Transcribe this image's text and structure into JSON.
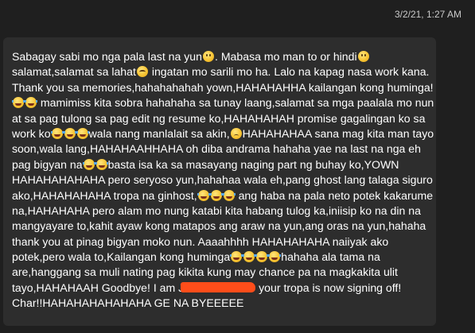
{
  "message": {
    "timestamp": "3/2/21, 1:27 AM",
    "lines": [
      [
        "Sabagay sabi mo nga pala last na yun",
        {
          "emoji": "smile"
        },
        ". Mabasa mo man to or hindi",
        {
          "emoji": "smile"
        }
      ],
      [
        "salamat,salamat sa lahat",
        {
          "emoji": "blush"
        },
        " ingatan mo sarili mo ha. Lalo na kapag nasa work kana."
      ],
      [
        "Thank you sa memories,hahahahahah yown,HAHAHAHHA kailangan kong huminga!"
      ],
      [
        {
          "emoji": "joy"
        },
        {
          "emoji": "joy"
        },
        " mamimiss kita sobra hahahaha sa tunay laang,salamat sa mga paalala mo nun"
      ],
      [
        "at sa pag tulong sa pag edit ng resume ko,HAHAHAHAH promise gagalingan ko sa"
      ],
      [
        "work ko",
        {
          "emoji": "joy"
        },
        {
          "emoji": "joy"
        },
        {
          "emoji": "joy"
        },
        "wala nang manlalait sa akin,",
        {
          "emoji": "sad"
        },
        "HAHAHAHAA sana mag kita man tayo"
      ],
      [
        "soon,wala lang,HAHAHAAHHAHA oh diba andrama hahaha yae na last na nga eh"
      ],
      [
        "pag bigyan na",
        {
          "emoji": "joy"
        },
        {
          "emoji": "joy"
        },
        "basta isa ka sa masayang naging part ng buhay ko,YOWN"
      ],
      [
        "HAHAHAHAHAHA pero seryoso yun,hahahaa wala eh,pang ghost lang talaga siguro"
      ],
      [
        "ako,HAHAHAHAHA tropa na ginhost,",
        {
          "emoji": "joy"
        },
        {
          "emoji": "joy"
        },
        {
          "emoji": "joy"
        },
        " ang haba na pala neto potek kakarume"
      ],
      [
        "na,HAHAHAHA pero alam mo nung katabi kita habang tulog ka,iniisip ko na din na"
      ],
      [
        "mangyayare to,kahit ayaw kong matapos ang araw na yun,ang oras na yun,hahaha"
      ],
      [
        "thank you at pinag bigyan moko nun. Aaaahhhh HAHAHAHAHA naiiyak ako"
      ],
      [
        "potek,pero wala to,Kailangan kong huminga",
        {
          "emoji": "joy"
        },
        {
          "emoji": "joy"
        },
        {
          "emoji": "joy"
        },
        {
          "emoji": "joy"
        },
        "hahaha ala tama na"
      ],
      [
        "are,hanggang sa muli nating pag kikita kung may chance pa na magkakita ulit"
      ],
      [
        "tayo,HAHAHAAH Goodbye! I am J",
        {
          "redacted": true
        },
        " your tropa is now signing off!"
      ],
      [
        "Char!!HAHAHAHAHAHAHA GE NA BYEEEEE"
      ]
    ]
  },
  "colors": {
    "background": "#1f1f1f",
    "bubble": "#2d2d2d",
    "text": "#ffffff",
    "timestamp": "#c9c9c9",
    "redaction": "#ff4d1a"
  },
  "icons": {
    "smile": "slightly-smiling-face-emoji",
    "blush": "smiling-face-with-smiling-eyes-emoji",
    "joy": "face-with-tears-of-joy-emoji",
    "sad": "pensive-face-emoji"
  }
}
